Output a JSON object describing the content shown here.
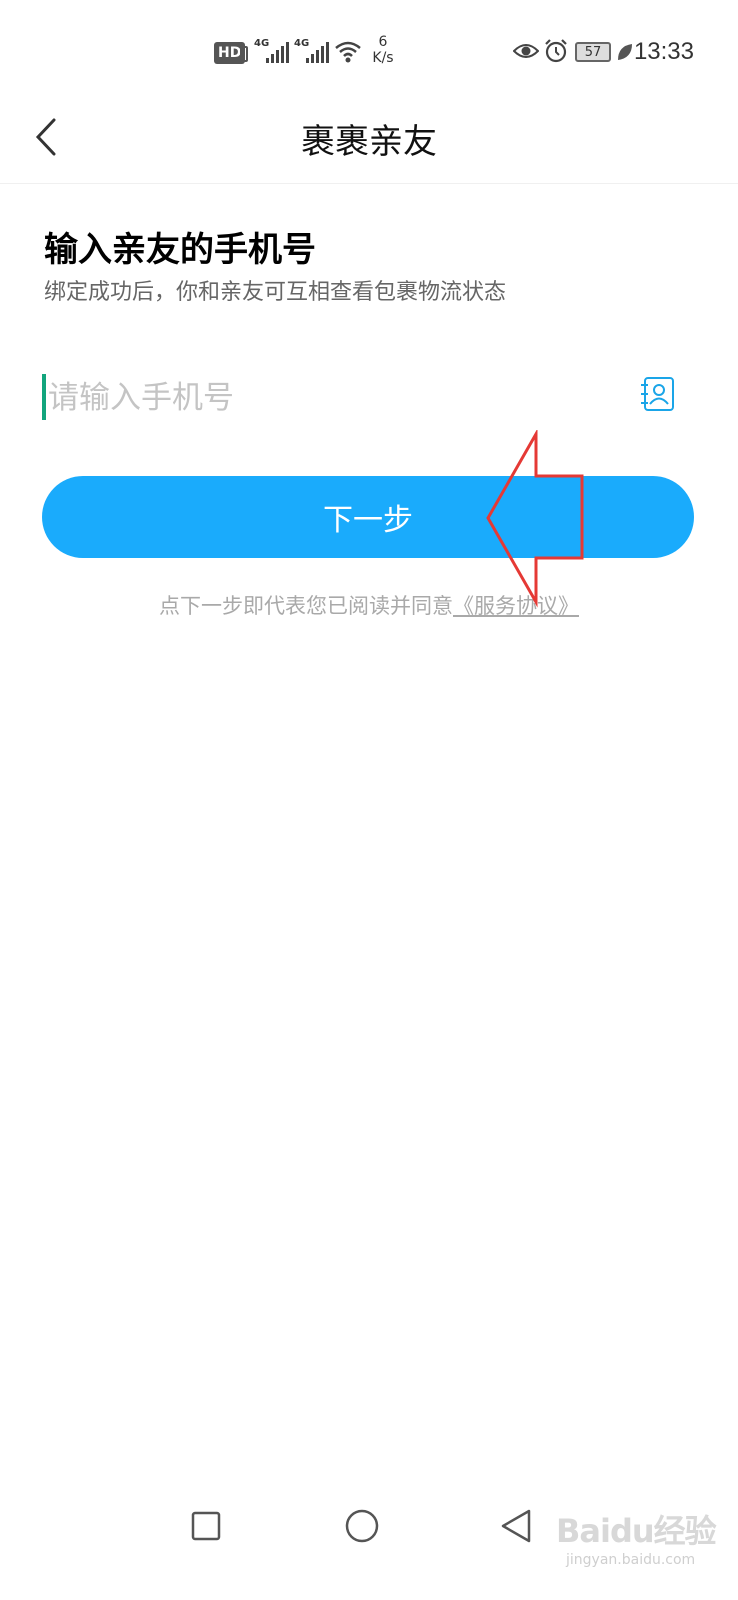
{
  "status_bar": {
    "hd_label": "HD",
    "signal1_label": "4G",
    "signal2_label": "4G",
    "speed_value": "6",
    "speed_unit": "K/s",
    "battery": "57",
    "time": "13:33"
  },
  "header": {
    "title": "裹裹亲友"
  },
  "main": {
    "heading": "输入亲友的手机号",
    "subheading": "绑定成功后，你和亲友可互相查看包裹物流状态",
    "phone_placeholder": "请输入手机号",
    "phone_value": "",
    "next_label": "下一步",
    "agreement_prefix": "点下一步即代表您已阅读并同意",
    "agreement_link": "《服务协议》"
  },
  "annotation": {
    "arrow_color": "#e53935"
  },
  "watermark": {
    "logo": "Baidu经验",
    "sub": "jingyan.baidu.com"
  },
  "colors": {
    "primary": "#1aabfc",
    "caret": "#12a57d",
    "contacts_icon": "#1aa5e8"
  }
}
